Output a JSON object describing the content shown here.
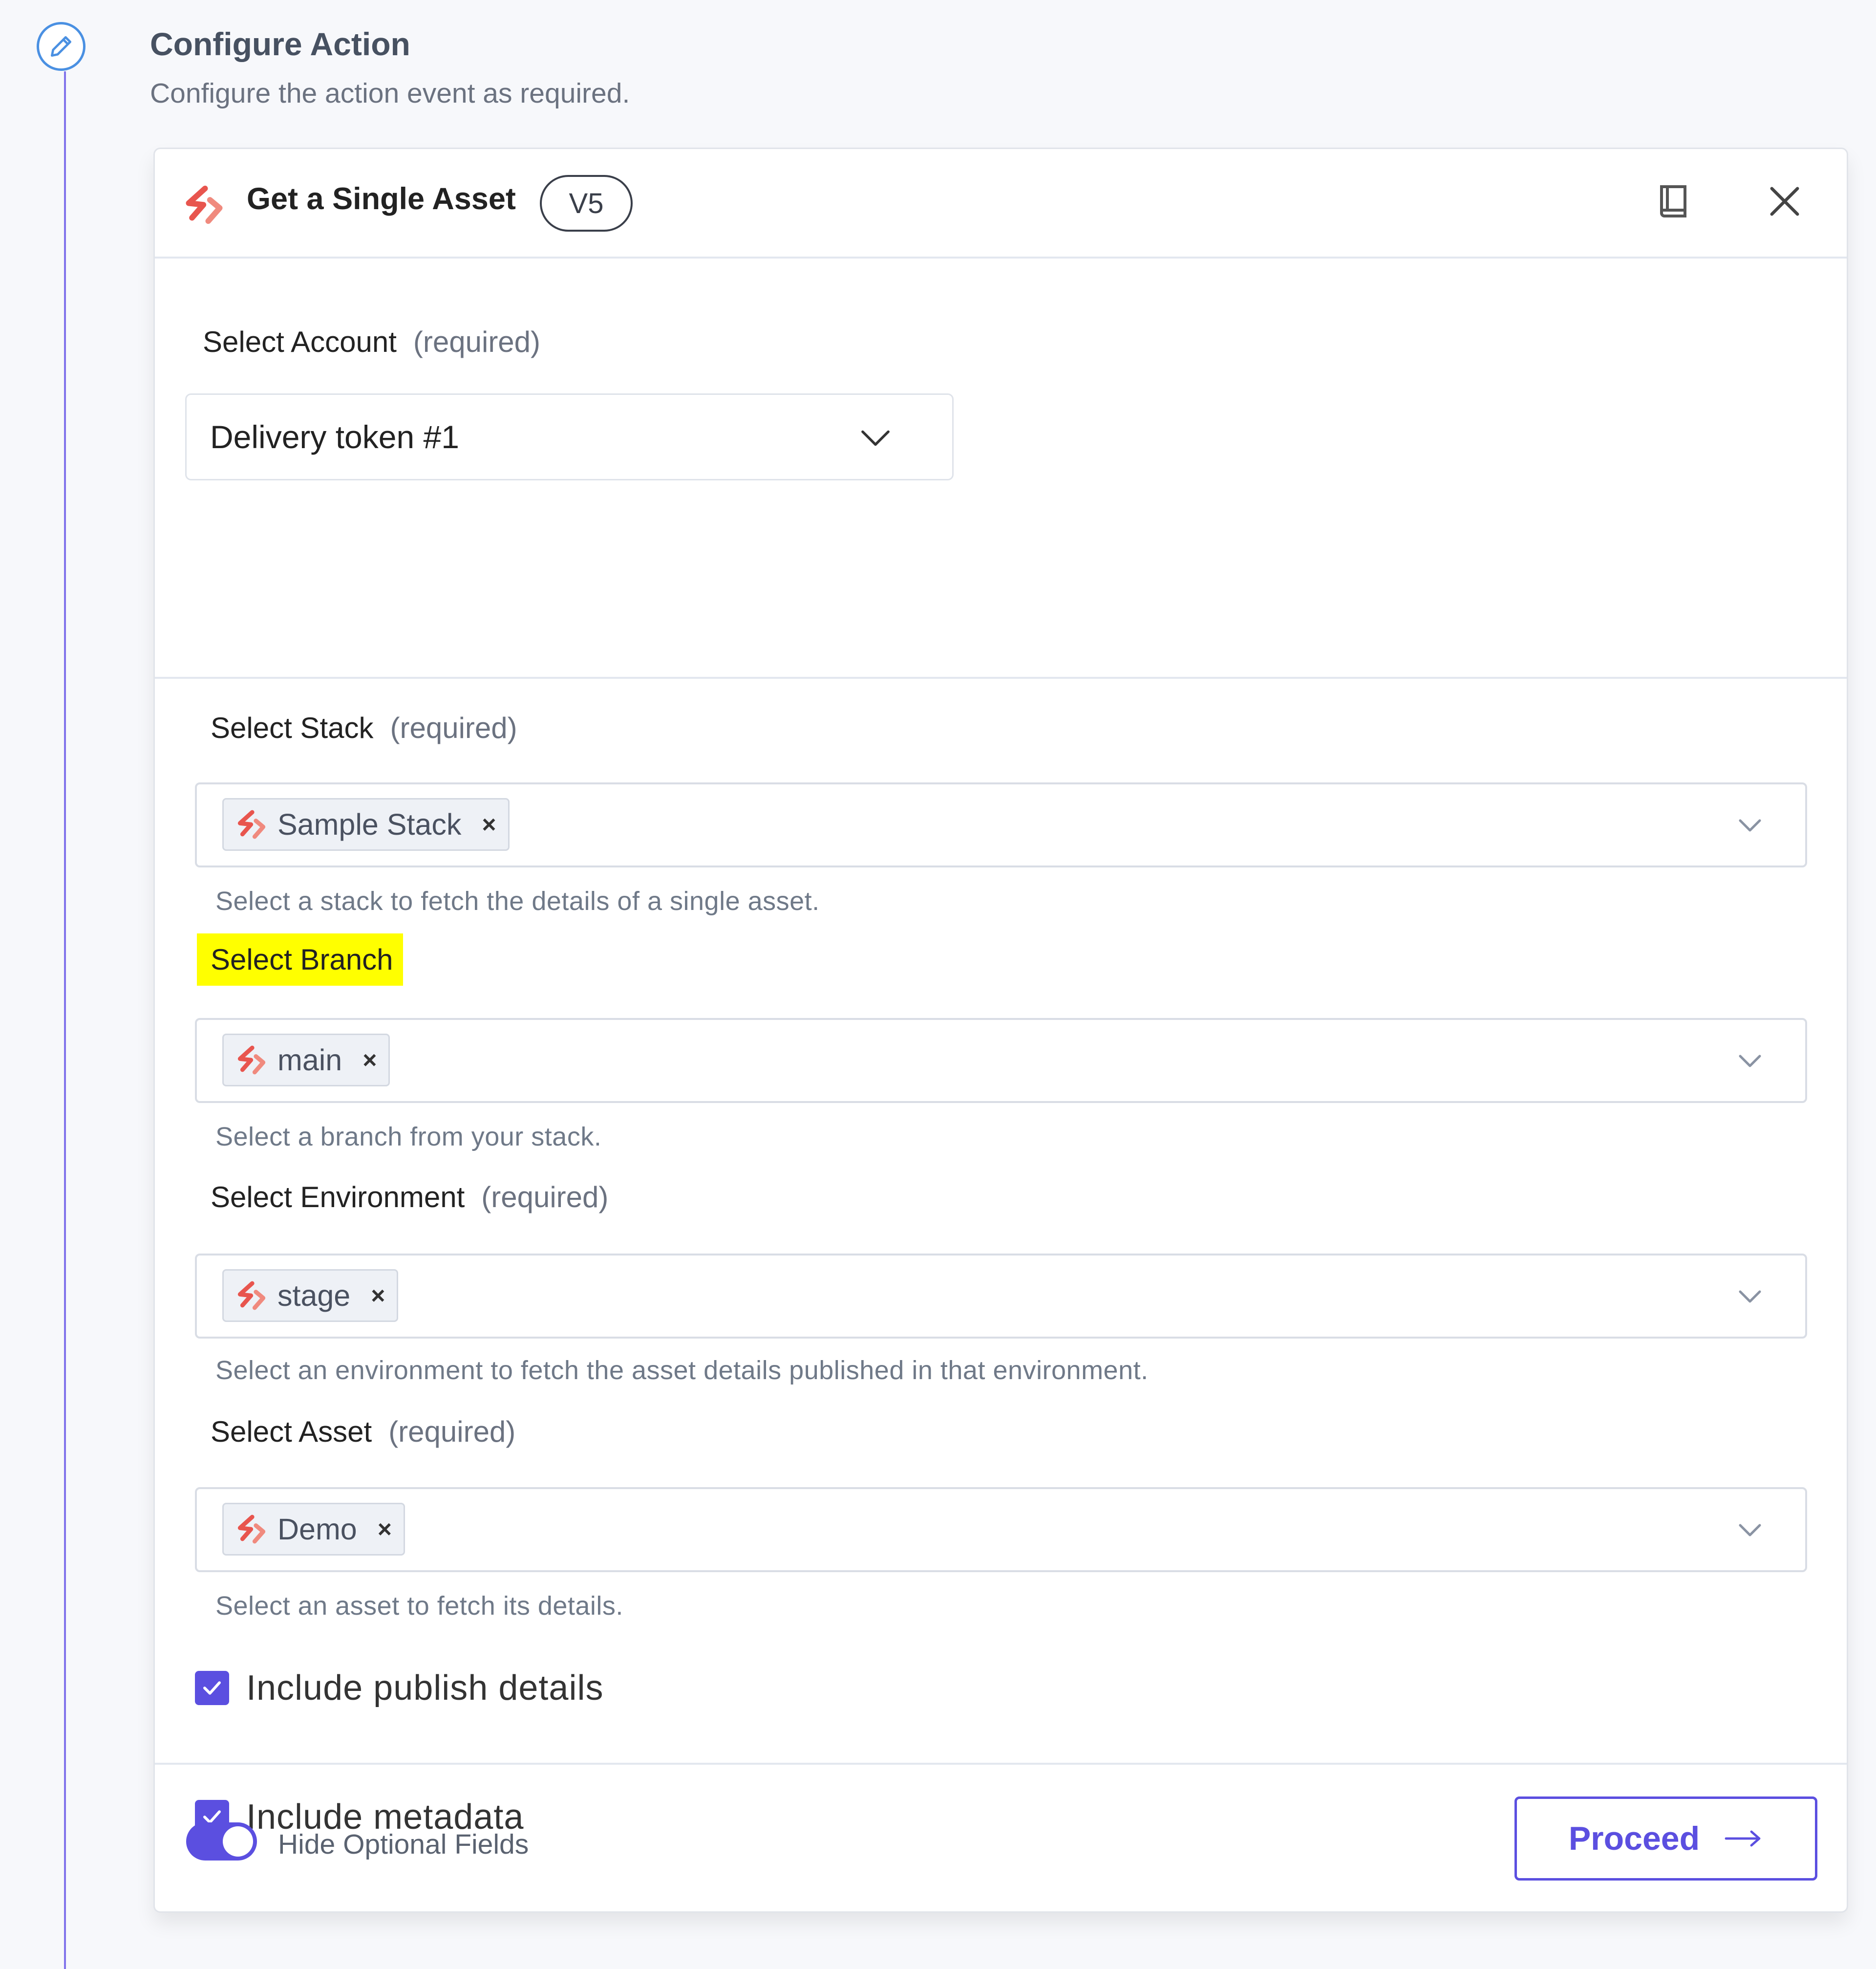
{
  "step": {
    "title": "Configure Action",
    "subtitle": "Configure the action event as required.",
    "icon": "pencil-icon"
  },
  "card": {
    "title": "Get a Single Asset",
    "version": "V5",
    "icons": {
      "logo": "contentstack-logo-icon",
      "docs": "book-icon",
      "close": "close-icon"
    }
  },
  "account": {
    "label": "Select Account",
    "required": "(required)",
    "value": "Delivery token #1"
  },
  "fields": {
    "stack": {
      "label": "Select Stack",
      "required": "(required)",
      "tag": "Sample Stack",
      "help": "Select a stack to fetch the details of a single asset."
    },
    "branch": {
      "label": "Select Branch",
      "tag": "main",
      "help": "Select a branch from your stack."
    },
    "environment": {
      "label": "Select Environment",
      "required": "(required)",
      "tag": "stage",
      "help": "Select an environment to fetch the asset details published in that environment."
    },
    "asset": {
      "label": "Select Asset",
      "required": "(required)",
      "tag": "Demo",
      "help": "Select an asset to fetch its details."
    }
  },
  "checkboxes": {
    "publish_details": {
      "label": "Include publish details",
      "checked": true
    },
    "metadata": {
      "label": "Include metadata",
      "checked": true
    }
  },
  "footer": {
    "toggle_label": "Hide Optional Fields",
    "toggle_on": true,
    "proceed_label": "Proceed"
  },
  "colors": {
    "accent": "#5b4fe0",
    "highlight": "#ffff00",
    "brand": "#e8554e"
  }
}
